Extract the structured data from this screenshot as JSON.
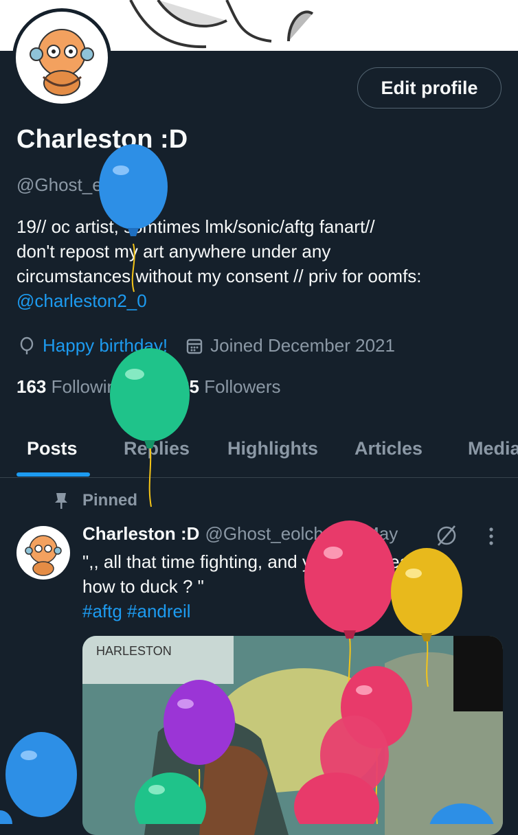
{
  "profile": {
    "edit_label": "Edit profile",
    "name": "Charleston :D",
    "handle": "@Ghost_eolch",
    "bio_lines": [
      "19// oc artist, somtimes lmk/sonic/aftg fanart//",
      "don't repost my art anywhere under any",
      "circumstances without my consent //  priv for oomfs:"
    ],
    "bio_link": "@charleston2_0",
    "birthday": "Happy birthday!",
    "joined": "Joined December 2021",
    "following_count": "163",
    "following_label": "Following",
    "followers_count": "6,135",
    "followers_label": "Followers"
  },
  "tabs": [
    {
      "label": "Posts"
    },
    {
      "label": "Replies"
    },
    {
      "label": "Highlights"
    },
    {
      "label": "Articles"
    },
    {
      "label": "Media"
    }
  ],
  "pinned_label": "Pinned",
  "post": {
    "name": "Charleston :D",
    "handle_time": "@Ghost_eolch · 22 May",
    "text_lines": [
      "\",, all that time fighting, and you never learned",
      "how to duck ? \""
    ],
    "hashtags": "#aftg #andreil",
    "media_caption": "HARLESTON"
  },
  "colors": {
    "background": "#15202b",
    "accent": "#1d9bf0",
    "muted": "#8b98a5"
  },
  "icons": [
    "balloon-icon",
    "calendar-icon",
    "pin-icon",
    "grok-icon",
    "more-icon"
  ]
}
